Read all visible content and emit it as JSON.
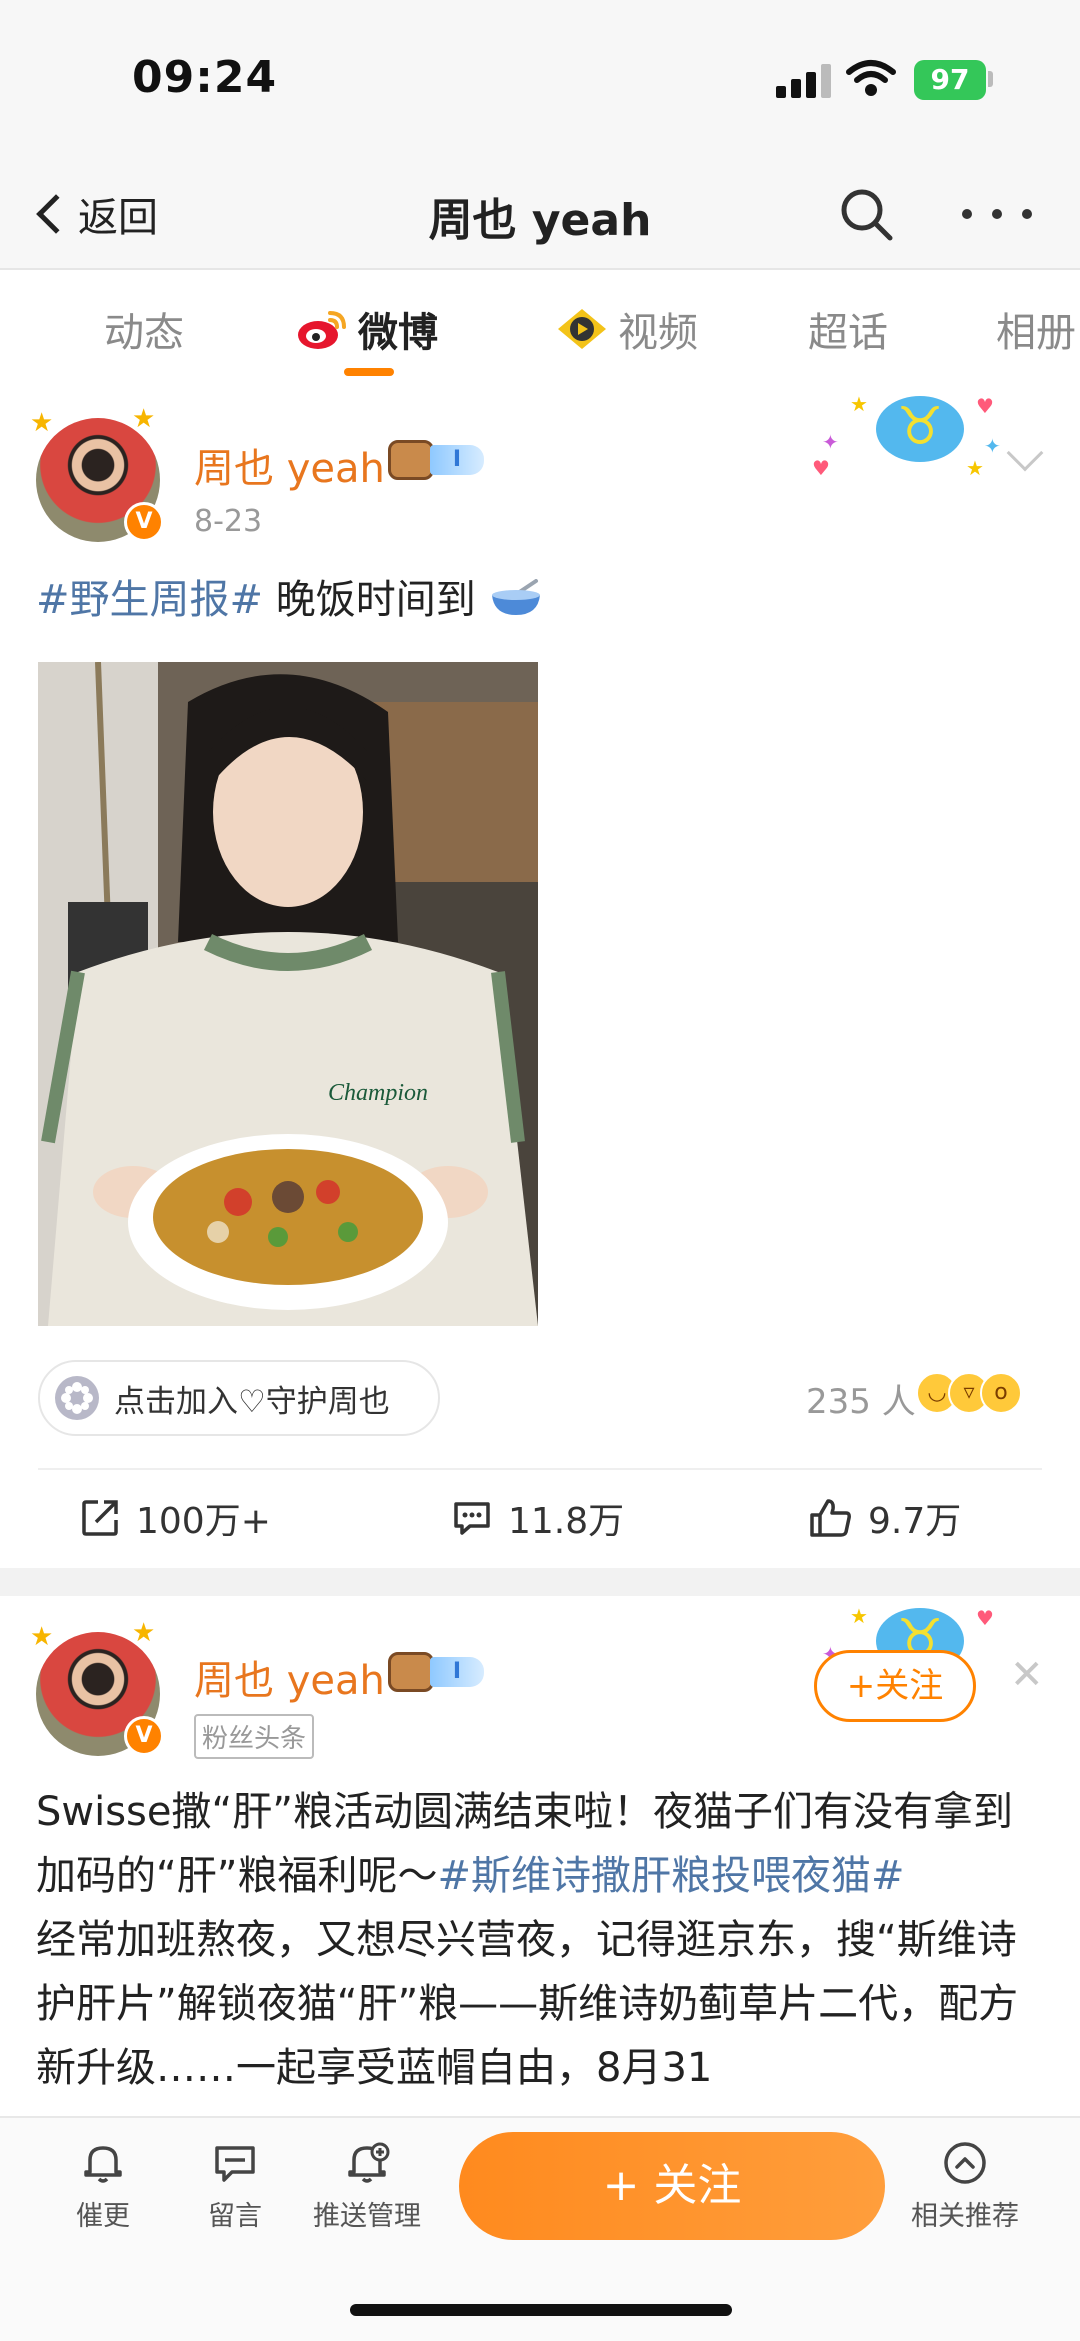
{
  "status_bar": {
    "time": "09:24",
    "battery": "97"
  },
  "nav": {
    "back_label": "返回",
    "title": "周也 yeah"
  },
  "tabs": [
    {
      "label": "动态",
      "active": false
    },
    {
      "label": "微博",
      "active": true,
      "icon": "weibo-logo-icon"
    },
    {
      "label": "视频",
      "active": false,
      "icon": "video-play-icon"
    },
    {
      "label": "超话",
      "active": false
    },
    {
      "label": "相册",
      "active": false
    }
  ],
  "post1": {
    "author": "周也 yeah",
    "level_badge": "I",
    "date": "8-23",
    "topic": "#野生周报#",
    "text": " 晚饭时间到",
    "emoji": "bowl-icon",
    "image_caption": "Champion",
    "guard_label": "点击加入♡守护周也",
    "guard_count": "235 人",
    "actions": {
      "reposts": "100万+",
      "comments": "11.8万",
      "likes": "9.7万"
    }
  },
  "post2": {
    "author": "周也 yeah",
    "level_badge": "I",
    "fans_tag": "粉丝头条",
    "follow_label": "+关注",
    "text_part1": "Swisse撒“肝”粮活动圆满结束啦！夜猫子们有没有拿到加码的“肝”粮福利呢～",
    "topic": "#斯维诗撒肝粮投喂夜猫#",
    "text_part2": "经常加班熬夜，又想尽兴营夜，记得逛京东，搜“斯维诗护肝片”解锁夜猫“肝”粮——斯维诗奶蓟草片二代，配方新升级……一起享受蓝帽自由，8月31"
  },
  "bottom_bar": {
    "items": [
      {
        "label": "催更",
        "icon": "bell-icon"
      },
      {
        "label": "留言",
        "icon": "message-icon"
      },
      {
        "label": "推送管理",
        "icon": "bell-plus-icon"
      },
      {
        "label": "相关推荐",
        "icon": "chevron-up-circle-icon"
      }
    ],
    "follow_label": "+ 关注"
  },
  "colors": {
    "accent": "#ff8200",
    "topic": "#4f76a6",
    "username": "#e8761e"
  }
}
